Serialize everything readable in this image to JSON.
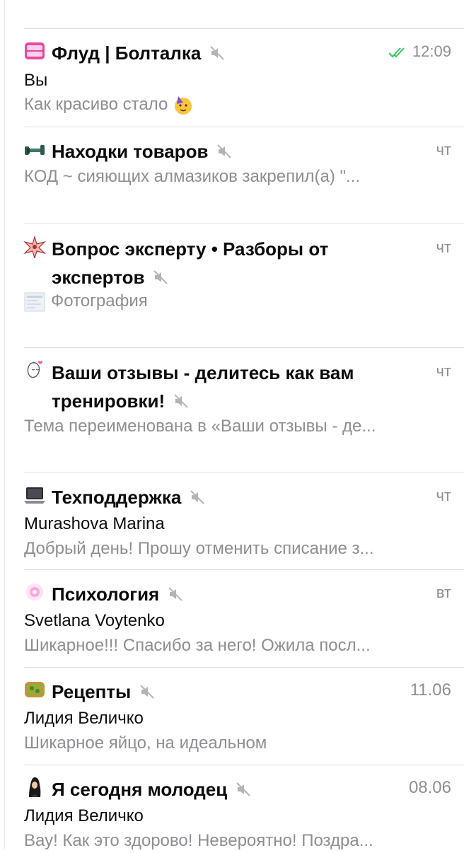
{
  "colors": {
    "text": "#0c0c0c",
    "secondary": "#8e8e93",
    "read_check": "#34c759",
    "separator": "#dcdce0"
  },
  "topics": [
    {
      "title": "Флуд | Болталка",
      "muted": true,
      "time": "12:09",
      "read_checks": true,
      "sender": "Вы",
      "preview": "Как красиво стало",
      "preview_emoji": "partying-face",
      "icon": "girl-power-sticker-icon"
    },
    {
      "title": "Находки товаров",
      "muted": true,
      "time": "чт",
      "preview": "КОД ~ сияющих алмазиков закрепил(а) \"...",
      "icon": "dumbbell-icon"
    },
    {
      "title": "Вопрос эксперту • Разборы от экспертов",
      "muted": true,
      "time": "чт",
      "preview": "Фотография",
      "preview_emoji": "photo-thumbnail",
      "icon": "star-burst-icon"
    },
    {
      "title": "Ваши отзывы - делитесь как вам тренировки!",
      "muted": true,
      "time": "чт",
      "preview": "Тема переименована в «Ваши отзывы - де...",
      "icon": "girl-sketch-icon"
    },
    {
      "title": "Техподдержка",
      "muted": true,
      "time": "чт",
      "sender": "Murashova Marina",
      "preview": "Добрый день! Прошу отменить списание з...",
      "icon": "laptop-icon"
    },
    {
      "title": "Психология",
      "muted": true,
      "time": "вт",
      "sender": "Svetlana Voytenko",
      "preview": "Шикарное!!! Спасибо за него! Ожила посл...",
      "icon": "pink-glow-icon"
    },
    {
      "title": "Рецепты",
      "muted": true,
      "time": "11.06",
      "sender": "Лидия Величко",
      "preview": "Шикарное яйцо, на идеальном",
      "icon": "avocado-toast-icon"
    },
    {
      "title": "Я сегодня молодец",
      "muted": true,
      "time": "08.06",
      "sender": "Лидия Величко",
      "preview": "Вау! Как это здорово! Невероятно! Поздра...",
      "icon": "woman-silhouette-icon"
    }
  ]
}
